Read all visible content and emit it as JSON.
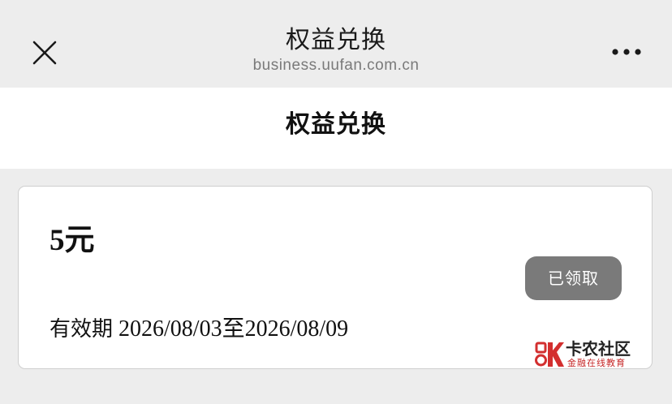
{
  "nav": {
    "title": "权益兑换",
    "domain": "business.uufan.com.cn"
  },
  "header": {
    "title": "权益兑换"
  },
  "coupon": {
    "amount": "5元",
    "status_button": "已领取",
    "validity_label": "有效期",
    "validity_range": " 2026/08/03至2026/08/09"
  },
  "watermark": {
    "name": "卡农社区",
    "tagline": "金融在线教育"
  },
  "colors": {
    "background": "#ededed",
    "card": "#ffffff",
    "claimed_button": "#7a7a7a",
    "watermark_red": "#d32f2f"
  },
  "icons": {
    "close": "close-icon",
    "more": "more-icon",
    "watermark_logo": "kanong-logo-icon"
  }
}
